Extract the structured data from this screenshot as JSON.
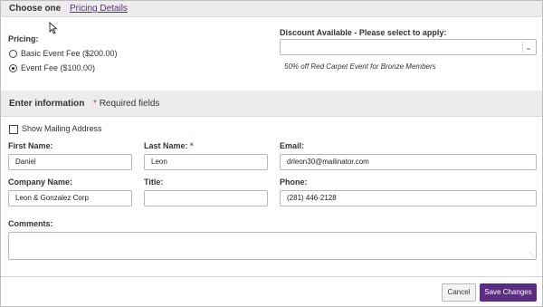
{
  "top_bar": {
    "title": "Choose one",
    "link": "Pricing Details"
  },
  "pricing": {
    "label": "Pricing:",
    "options": [
      {
        "label": "Basic Event Fee ($200.00)",
        "selected": false
      },
      {
        "label": "Event Fee ($100.00)",
        "selected": true
      }
    ]
  },
  "discount": {
    "label": "Discount Available - Please select to apply:",
    "selected": "",
    "note": "50% off Red Carpet Event for Bronze Members"
  },
  "info_bar": {
    "title": "Enter information",
    "required_star": "*",
    "required_text": "Required fields"
  },
  "mailing": {
    "label": "Show Mailing Address",
    "checked": false
  },
  "form": {
    "first_name": {
      "label": "First Name:",
      "value": "Daniel"
    },
    "last_name": {
      "label": "Last Name:",
      "required": "*",
      "value": "Leon"
    },
    "email": {
      "label": "Email:",
      "value": "drleon30@mailinator.com"
    },
    "company": {
      "label": "Company Name:",
      "value": "Leon & Gonzalez Corp"
    },
    "title": {
      "label": "Title:",
      "value": ""
    },
    "phone": {
      "label": "Phone:",
      "value": "(281) 446-2128"
    },
    "comments": {
      "label": "Comments:",
      "value": ""
    }
  },
  "buttons": {
    "cancel": "Cancel",
    "save": "Save Changes"
  },
  "colors": {
    "accent": "#5b2c83",
    "required": "#c0392b",
    "bar": "#ececec"
  }
}
